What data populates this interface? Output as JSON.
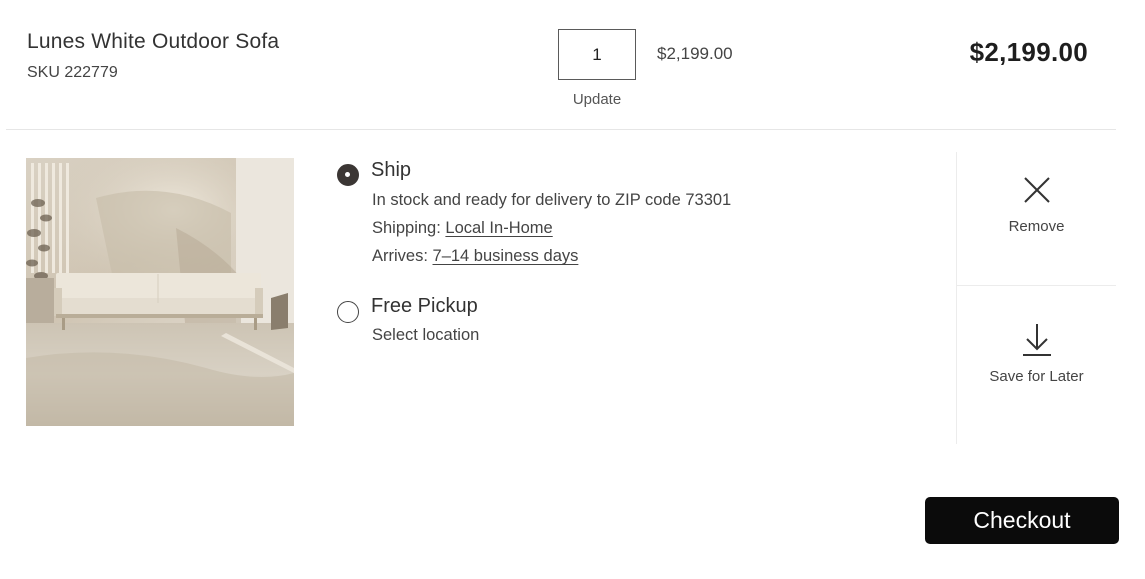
{
  "item": {
    "name": "Lunes White Outdoor Sofa",
    "sku": "SKU 222779",
    "quantity": "1",
    "update_label": "Update",
    "unit_price": "$2,199.00",
    "line_total": "$2,199.00"
  },
  "delivery": {
    "ship": {
      "label": "Ship",
      "selected": true,
      "stock_text": "In stock and ready for delivery to ZIP code 73301",
      "shipping_prefix": "Shipping:",
      "shipping_method": "Local In-Home",
      "arrives_prefix": "Arrives:",
      "arrives_window": "7–14 business days"
    },
    "pickup": {
      "label": "Free Pickup",
      "selected": false,
      "location_text": "Select location"
    }
  },
  "actions": {
    "remove_label": "Remove",
    "save_label": "Save for Later",
    "remove_icon": "close-icon",
    "save_icon": "download-arrow-icon"
  },
  "checkout": {
    "label": "Checkout"
  },
  "colors": {
    "checkout_bg": "#0b0b0b",
    "radio_selected": "#3b3634",
    "divider": "#e6e6e6"
  }
}
